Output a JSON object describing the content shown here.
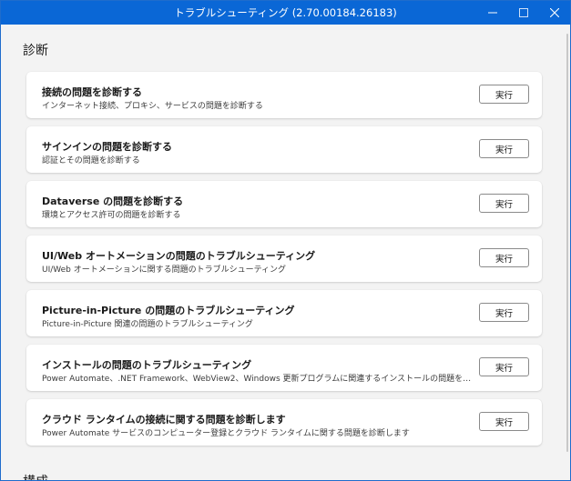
{
  "window": {
    "title": "トラブルシューティング (2.70.00184.26183)"
  },
  "sections": {
    "diagnose": "診断",
    "config": "構成"
  },
  "items": [
    {
      "title": "接続の問題を診断する",
      "desc": "インターネット接続、プロキシ、サービスの問題を診断する",
      "button": "実行"
    },
    {
      "title": "サインインの問題を診断する",
      "desc": "認証とその問題を診断する",
      "button": "実行"
    },
    {
      "title": "Dataverse の問題を診断する",
      "desc": "環境とアクセス許可の問題を診断する",
      "button": "実行"
    },
    {
      "title": "UI/Web オートメーションの問題のトラブルシューティング",
      "desc": "UI/Web オートメーションに関する問題のトラブルシューティング",
      "button": "実行"
    },
    {
      "title": "Picture-in-Picture の問題のトラブルシューティング",
      "desc": "Picture-in-Picture 関連の問題のトラブルシューティング",
      "button": "実行"
    },
    {
      "title": "インストールの問題のトラブルシューティング",
      "desc": "Power Automate、.NET Framework、WebView2、Windows 更新プログラムに関連するインストールの問題をトラブルシュー…",
      "button": "実行"
    },
    {
      "title": "クラウド ランタイムの接続に関する問題を診断します",
      "desc": "Power Automate サービスのコンピューター登録とクラウド ランタイムに関する問題を診断します",
      "button": "実行"
    }
  ],
  "icons": {
    "minimize": "minimize-icon",
    "maximize": "maximize-icon",
    "close": "close-icon"
  }
}
